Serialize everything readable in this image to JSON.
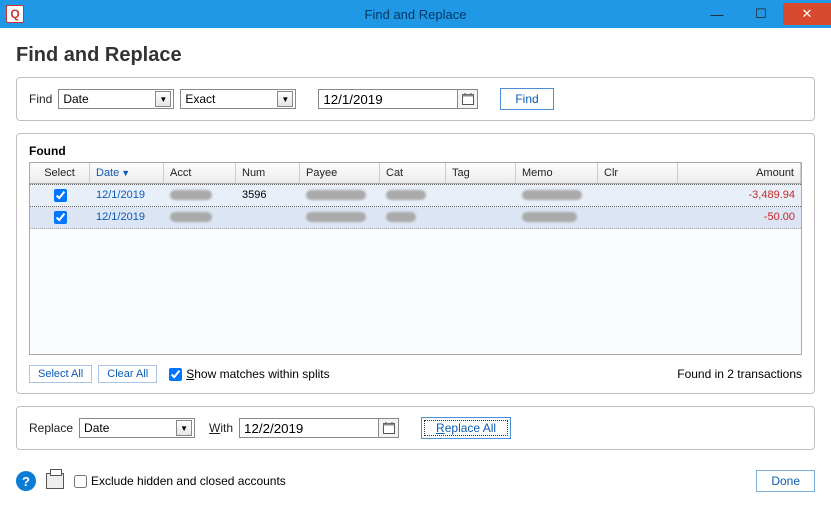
{
  "titlebar": {
    "title": "Find and Replace",
    "app_icon_letter": "Q"
  },
  "heading": "Find and Replace",
  "find": {
    "label": "Find",
    "field": "Date",
    "match": "Exact",
    "value": "12/1/2019",
    "button": "Find"
  },
  "found": {
    "label": "Found",
    "columns": {
      "select": "Select",
      "date": "Date",
      "acct": "Acct",
      "num": "Num",
      "payee": "Payee",
      "cat": "Cat",
      "tag": "Tag",
      "memo": "Memo",
      "clr": "Clr",
      "amount": "Amount"
    },
    "rows": [
      {
        "checked": true,
        "date": "12/1/2019",
        "num": "3596",
        "amount": "-3,489.94"
      },
      {
        "checked": true,
        "date": "12/1/2019",
        "num": "",
        "amount": "-50.00"
      }
    ],
    "select_all": "Select All",
    "clear_all": "Clear All",
    "show_matches": "how matches within splits",
    "status": "Found in 2 transactions"
  },
  "replace": {
    "label": "Replace",
    "field": "Date",
    "with_label": "ith",
    "value": "12/2/2019",
    "button": "eplace All"
  },
  "footer": {
    "exclude": "Exclude hidden and closed accounts",
    "done": "Done"
  }
}
